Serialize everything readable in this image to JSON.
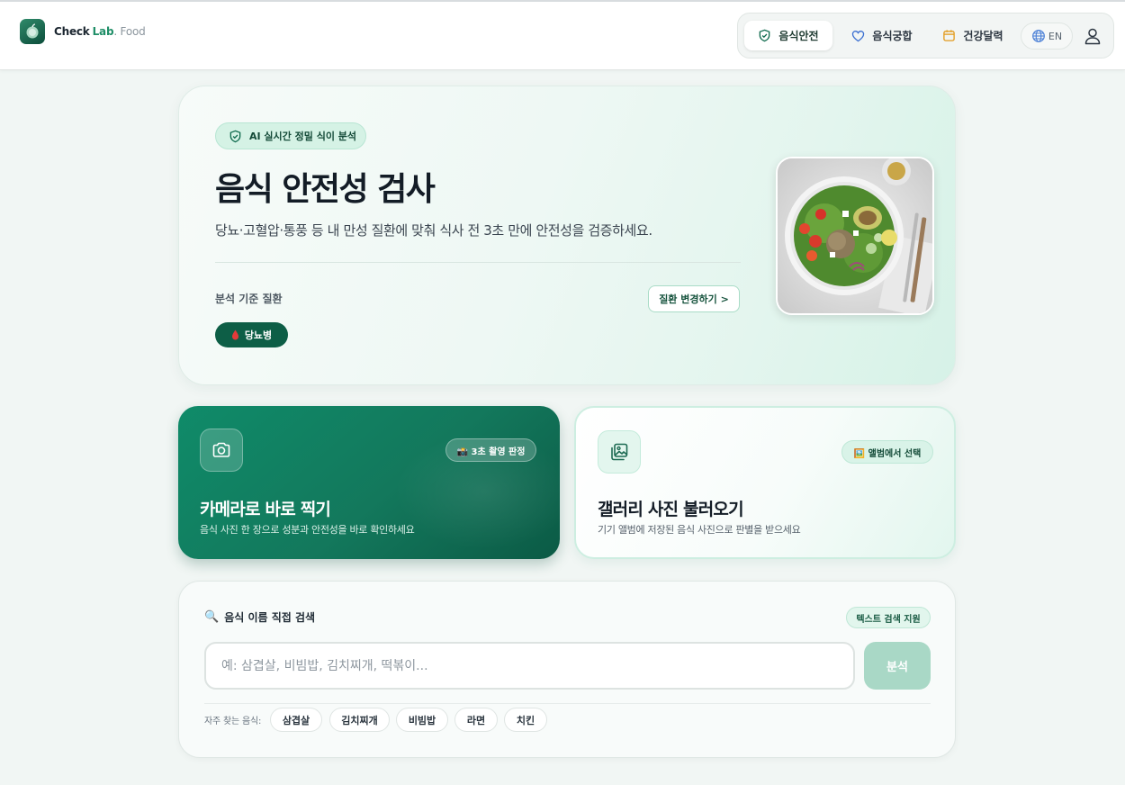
{
  "header": {
    "logo": {
      "part1": "Check",
      "part2": "Lab",
      "part3": ". Food"
    },
    "nav": [
      {
        "label": "음식안전",
        "icon": "shield-check-icon",
        "active": true
      },
      {
        "label": "음식궁합",
        "icon": "heart-icon",
        "active": false
      },
      {
        "label": "건강달력",
        "icon": "calendar-icon",
        "active": false
      }
    ],
    "lang": {
      "label": "EN",
      "icon": "globe-icon"
    },
    "user_icon": "user-icon"
  },
  "hero": {
    "badge": "AI 실시간 정밀 식이 분석",
    "title": "음식 안전성 검사",
    "subtitle": "당뇨·고혈압·통풍 등 내 만성 질환에 맞춰 식사 전 3초 만에 안전성을 검증하세요.",
    "disease_label": "분석 기준 질환",
    "change_button": "질환 변경하기 >",
    "selected_disease": "당뇨병",
    "image_alt": "salad-bowl-image"
  },
  "camera_card": {
    "tag": "📸 3초 촬영 판정",
    "title": "카메라로 바로 찍기",
    "desc": "음식 사진 한 장으로 성분과 안전성을 바로 확인하세요"
  },
  "gallery_card": {
    "tag": "🖼️ 앨범에서 선택",
    "title": "갤러리 사진 불러오기",
    "desc": "기기 앨범에 저장된 음식 사진으로 판별을 받으세요"
  },
  "search": {
    "title": "음식 이름 직접 검색",
    "tag": "텍스트 검색 지원",
    "placeholder": "예: 삼겹살, 비빔밥, 김치찌개, 떡볶이...",
    "button": "분석",
    "freq_label": "자주 찾는 음식:",
    "freq_items": [
      "삼겹살",
      "김치찌개",
      "비빔밥",
      "라면",
      "치킨"
    ]
  },
  "colors": {
    "brand": "#0d5e46",
    "accent": "#1f8e67",
    "camera_card": "#13785c",
    "analyze_button_disabled": "#a9d8c6"
  }
}
